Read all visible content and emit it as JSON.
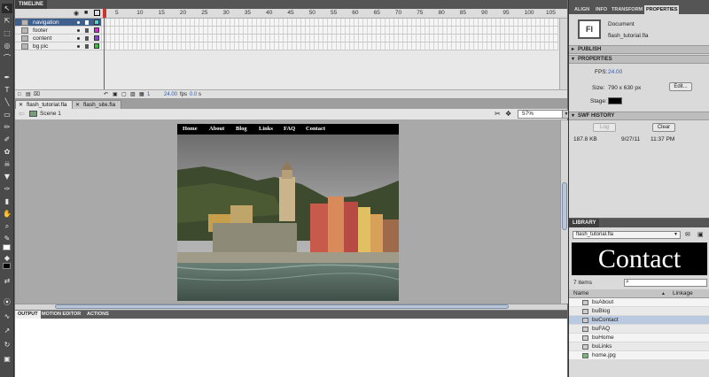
{
  "timeline": {
    "tab_label": "TIMELINE",
    "frame_numbers": [
      "5",
      "10",
      "15",
      "20",
      "25",
      "30",
      "35",
      "40",
      "45",
      "50",
      "55",
      "60",
      "65",
      "70",
      "75",
      "80",
      "85",
      "90",
      "95",
      "100",
      "105"
    ],
    "layers": [
      {
        "name": "navigation",
        "active": true,
        "color": "#55d4d4"
      },
      {
        "name": "footer",
        "active": false,
        "color": "#cc33cc"
      },
      {
        "name": "content",
        "active": false,
        "color": "#8844cc"
      },
      {
        "name": "bg pic",
        "active": false,
        "color": "#44bb44"
      }
    ],
    "footer": {
      "current_frame": "1",
      "fps": "24.00",
      "fps_unit": "fps",
      "time": "0.0",
      "time_unit": "s"
    }
  },
  "documents": {
    "tabs": [
      {
        "label": "flash_tutorial.fla",
        "active": true
      },
      {
        "label": "flash_site.fla",
        "active": false
      }
    ]
  },
  "scene_bar": {
    "scene": "Scene 1",
    "zoom": "57%"
  },
  "stage": {
    "nav_items": [
      "Home",
      "About",
      "Blog",
      "Links",
      "FAQ",
      "Contact"
    ]
  },
  "output_panel": {
    "tabs": [
      "OUTPUT",
      "MOTION EDITOR",
      "ACTIONS"
    ]
  },
  "right_panel": {
    "tabs": [
      "ALIGN",
      "INFO",
      "TRANSFORM",
      "PROPERTIES"
    ],
    "doc_icon": "Fl",
    "doc_type": "Document",
    "doc_name": "flash_tutorial.fla",
    "publish_label": "PUBLISH",
    "properties_label": "PROPERTIES",
    "fps_label": "FPS:",
    "fps_value": "24.00",
    "size_label": "Size:",
    "size_value": "790 x 630 px",
    "edit_button": "Edit...",
    "stage_label": "Stage:",
    "stage_color": "#000000",
    "swf_history_label": "SWF HISTORY",
    "log_button": "Log",
    "clear_button": "Clear",
    "history": {
      "size": "187.8 KB",
      "date": "9/27/11",
      "time": "11:37 PM"
    }
  },
  "library": {
    "tab_label": "LIBRARY",
    "selected_file": "flash_tutorial.fla",
    "preview_text": "Contact",
    "item_count": "7 items",
    "col_name": "Name",
    "col_linkage": "Linkage",
    "items": [
      {
        "name": "buAbout",
        "selected": false
      },
      {
        "name": "buBlog",
        "selected": false
      },
      {
        "name": "buContact",
        "selected": true
      },
      {
        "name": "buFAQ",
        "selected": false
      },
      {
        "name": "buHome",
        "selected": false
      },
      {
        "name": "buLinks",
        "selected": false
      },
      {
        "name": "home.jpg",
        "selected": false
      }
    ]
  }
}
